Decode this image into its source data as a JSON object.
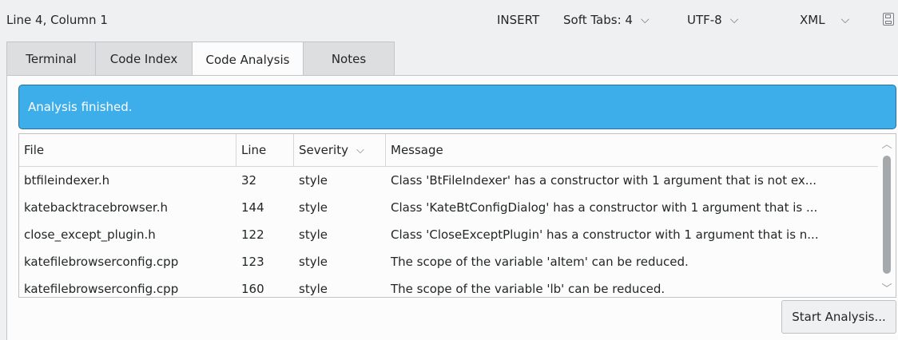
{
  "statusbar": {
    "position": "Line 4, Column 1",
    "mode": "INSERT",
    "indent": "Soft Tabs: 4",
    "encoding": "UTF-8",
    "syntax": "XML",
    "chevron": "⌵",
    "save_icon": "save-icon"
  },
  "tabs": [
    {
      "label": "Terminal",
      "active": false
    },
    {
      "label": "Code Index",
      "active": false
    },
    {
      "label": "Code Analysis",
      "active": true
    },
    {
      "label": "Notes",
      "active": false
    }
  ],
  "banner": {
    "text": "Analysis finished.",
    "color": "#3daee9"
  },
  "table": {
    "columns": {
      "file": "File",
      "line": "Line",
      "severity": "Severity",
      "message": "Message"
    },
    "sort_indicator": "⌵",
    "rows": [
      {
        "file": "btfileindexer.h",
        "line": "32",
        "severity": "style",
        "message": "Class 'BtFileIndexer' has a constructor with 1 argument that is not ex..."
      },
      {
        "file": "katebacktracebrowser.h",
        "line": "144",
        "severity": "style",
        "message": "Class 'KateBtConfigDialog' has a constructor with 1 argument that is ..."
      },
      {
        "file": "close_except_plugin.h",
        "line": "122",
        "severity": "style",
        "message": "Class 'CloseExceptPlugin' has a constructor with 1 argument that is n..."
      },
      {
        "file": "katefilebrowserconfig.cpp",
        "line": "123",
        "severity": "style",
        "message": "The scope of the variable 'aItem' can be reduced."
      },
      {
        "file": "katefilebrowserconfig.cpp",
        "line": "160",
        "severity": "style",
        "message": "The scope of the variable 'lb' can be reduced."
      }
    ],
    "scroll_up": "︿",
    "scroll_down": "﹀"
  },
  "actions": {
    "start_analysis": "Start Analysis..."
  }
}
